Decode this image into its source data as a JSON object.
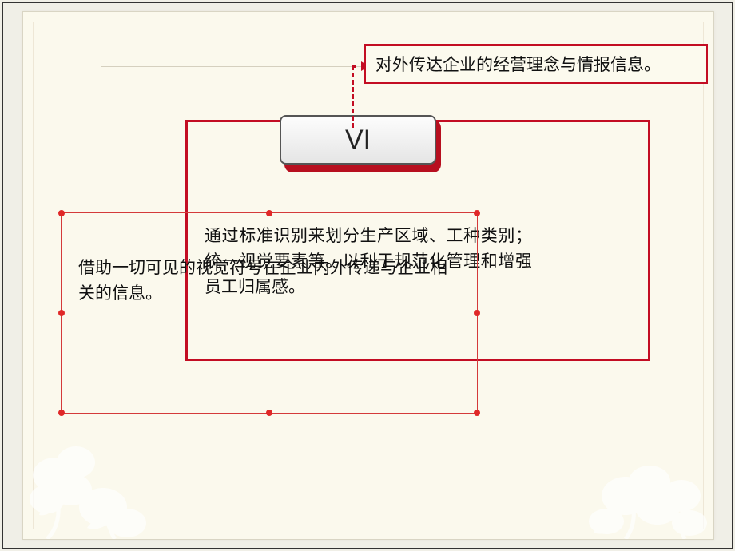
{
  "badge": {
    "label": "VI"
  },
  "callout": {
    "text": "对外传达企业的经营理念与情报信息。"
  },
  "body": {
    "text": "通过标准识别来划分生产区域、工种类别；统一视觉要素等。以利于规范化管理和增强员工归属感。"
  },
  "selection": {
    "text": "借助一切可见的视觉符号在企业内外传递与企业相关的信息。"
  },
  "colors": {
    "accent": "#c30d23",
    "paper": "#fbf9ed",
    "slide_bg": "#f0efe7"
  }
}
